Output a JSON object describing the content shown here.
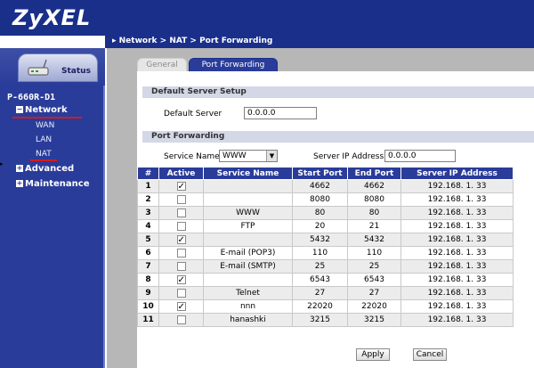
{
  "header": {
    "logo": "ZyXEL"
  },
  "breadcrumb": "▸ Network > NAT > Port Forwarding",
  "sidebar": {
    "status_label": "Status",
    "device_name": "P-660R-D1",
    "items": [
      {
        "label": "Network",
        "expanded": true
      },
      {
        "label": "Advanced",
        "expanded": false
      },
      {
        "label": "Maintenance",
        "expanded": false
      }
    ],
    "subitems": [
      "WAN",
      "LAN",
      "NAT"
    ]
  },
  "tabs": [
    {
      "label": "General",
      "active": false
    },
    {
      "label": "Port Forwarding",
      "active": true
    }
  ],
  "default_server": {
    "section_title": "Default Server Setup",
    "label": "Default Server",
    "value": "0.0.0.0"
  },
  "port_forwarding": {
    "section_title": "Port Forwarding",
    "service_name_label": "Service Name",
    "service_name_value": "WWW",
    "server_ip_label": "Server IP Address",
    "server_ip_value": "0.0.0.0"
  },
  "table": {
    "columns": [
      "#",
      "Active",
      "Service Name",
      "Start Port",
      "End Port",
      "Server IP Address"
    ],
    "rows": [
      {
        "num": "1",
        "active": true,
        "service": "",
        "start": "4662",
        "end": "4662",
        "ip": "192.168. 1. 33"
      },
      {
        "num": "2",
        "active": false,
        "service": "",
        "start": "8080",
        "end": "8080",
        "ip": "192.168. 1. 33"
      },
      {
        "num": "3",
        "active": false,
        "service": "WWW",
        "start": "80",
        "end": "80",
        "ip": "192.168. 1. 33"
      },
      {
        "num": "4",
        "active": false,
        "service": "FTP",
        "start": "20",
        "end": "21",
        "ip": "192.168. 1. 33"
      },
      {
        "num": "5",
        "active": true,
        "service": "",
        "start": "5432",
        "end": "5432",
        "ip": "192.168. 1. 33"
      },
      {
        "num": "6",
        "active": false,
        "service": "E-mail (POP3)",
        "start": "110",
        "end": "110",
        "ip": "192.168. 1. 33"
      },
      {
        "num": "7",
        "active": false,
        "service": "E-mail (SMTP)",
        "start": "25",
        "end": "25",
        "ip": "192.168. 1. 33"
      },
      {
        "num": "8",
        "active": true,
        "service": "",
        "start": "6543",
        "end": "6543",
        "ip": "192.168. 1. 33"
      },
      {
        "num": "9",
        "active": false,
        "service": "Telnet",
        "start": "27",
        "end": "27",
        "ip": "192.168. 1. 33"
      },
      {
        "num": "10",
        "active": true,
        "service": "nnn",
        "start": "22020",
        "end": "22020",
        "ip": "192.168. 1. 33"
      },
      {
        "num": "11",
        "active": false,
        "service": "hanashki",
        "start": "3215",
        "end": "3215",
        "ip": "192.168. 1. 33"
      }
    ]
  },
  "buttons": {
    "apply": "Apply",
    "cancel": "Cancel"
  },
  "colors": {
    "brand_blue": "#1a2f8a",
    "sidebar_blue": "#2a3c9a",
    "accent_red": "#d21c1c"
  }
}
